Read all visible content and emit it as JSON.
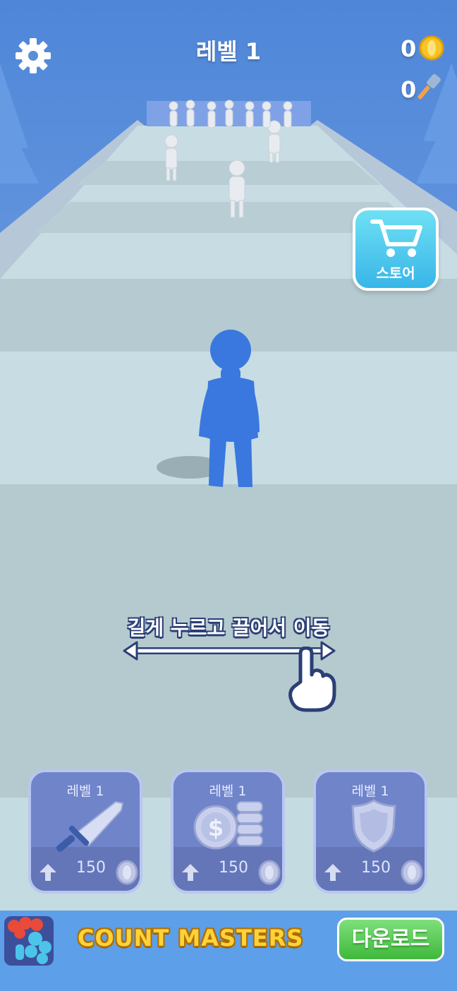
{
  "hud": {
    "level_title": "레벨 1",
    "coins": "0",
    "hammers": "0",
    "store_label": "스토어"
  },
  "hint": {
    "text": "길게 누르고 끌어서 이동"
  },
  "upgrades": [
    {
      "level": "레벨 1",
      "price": "150",
      "icon": "sword-icon"
    },
    {
      "level": "레벨 1",
      "price": "150",
      "icon": "coins-icon"
    },
    {
      "level": "레벨 1",
      "price": "150",
      "icon": "shield-icon"
    }
  ],
  "ad": {
    "title": "COUNT MASTERS",
    "download_label": "다운로드"
  },
  "colors": {
    "sky": "#5a8fd6",
    "player": "#3a78e0",
    "accent_store": "#3fc0ec",
    "download": "#45c040",
    "coin": "#f7c325"
  }
}
